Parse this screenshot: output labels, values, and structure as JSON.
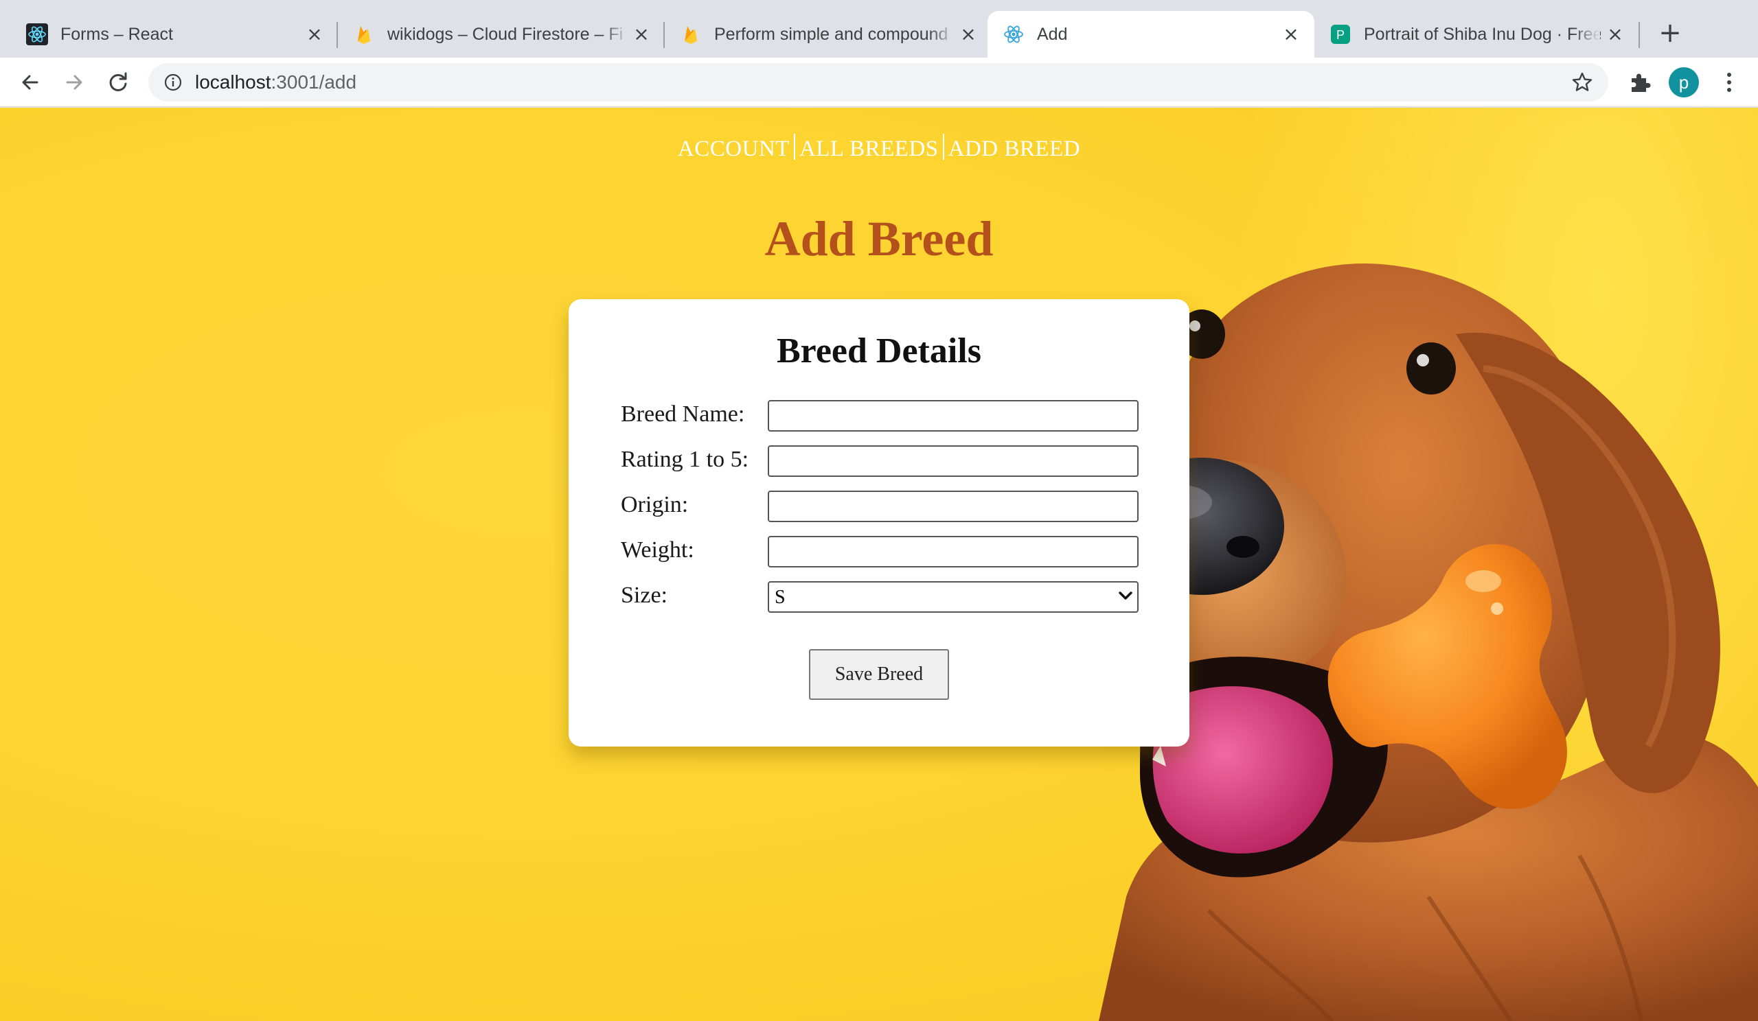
{
  "browser": {
    "tabs": [
      {
        "title": "Forms – React",
        "icon": "react-icon"
      },
      {
        "title": "wikidogs – Cloud Firestore – Fi",
        "icon": "firebase-icon"
      },
      {
        "title": "Perform simple and compound",
        "icon": "firebase-icon"
      },
      {
        "title": "Add",
        "icon": "react-icon",
        "active": true
      },
      {
        "title": "Portrait of Shiba Inu Dog · Free",
        "icon": "pexels-icon"
      }
    ],
    "url_host": "localhost",
    "url_path": ":3001/add",
    "avatar_initial": "p"
  },
  "nav": {
    "account": "ACCOUNT",
    "all_breeds": "ALL BREEDS",
    "add_breed": "ADD BREED"
  },
  "page_title": "Add Breed",
  "form": {
    "title": "Breed Details",
    "fields": [
      {
        "label": "Breed Name:",
        "value": ""
      },
      {
        "label": "Rating 1 to 5:",
        "value": ""
      },
      {
        "label": "Origin:",
        "value": ""
      },
      {
        "label": "Weight:",
        "value": ""
      }
    ],
    "size_label": "Size:",
    "size_value": "S",
    "save_label": "Save Breed"
  },
  "colors": {
    "background": "#fdd430",
    "title": "#b4501c",
    "avatar": "#12929e"
  }
}
